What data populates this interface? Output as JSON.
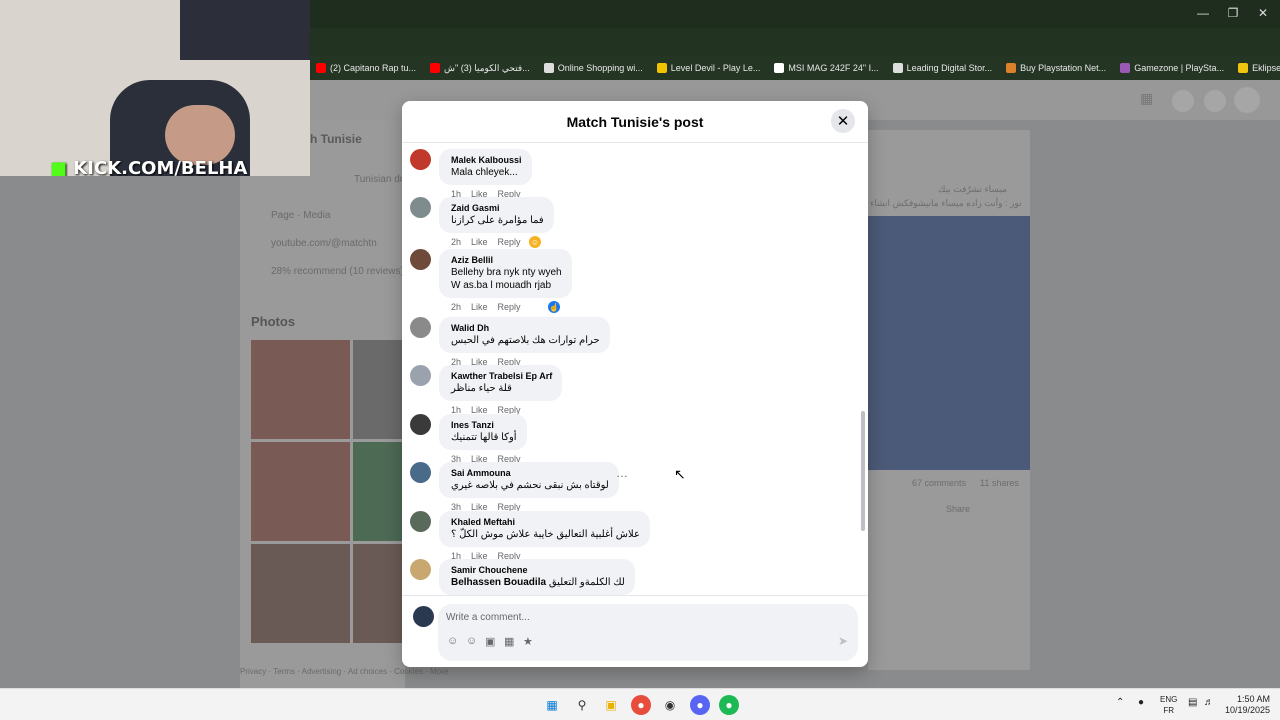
{
  "browser": {
    "bookmarks": [
      {
        "label": "(2) Capitano Rap tu...",
        "icon": "youtube-icon",
        "color": "#ff0000"
      },
      {
        "label": "فتحي الكوميا (3) \"ش...",
        "icon": "youtube-icon",
        "color": "#ff0000"
      },
      {
        "label": "Online Shopping wi...",
        "icon": "shopping-icon",
        "color": "#dddddd"
      },
      {
        "label": "Level Devil - Play Le...",
        "icon": "game-icon",
        "color": "#f2c300"
      },
      {
        "label": "MSI MAG 242F 24\" I...",
        "icon": "msi-icon",
        "color": "#ffffff"
      },
      {
        "label": "Leading Digital Stor...",
        "icon": "store-icon",
        "color": "#dddddd"
      },
      {
        "label": "Buy Playstation Net...",
        "icon": "playstation-icon",
        "color": "#d9822b"
      },
      {
        "label": "Gamezone | PlaySta...",
        "icon": "gamezone-icon",
        "color": "#9b59b6"
      },
      {
        "label": "Eklipse - Convert Tw...",
        "icon": "eklipse-icon",
        "color": "#f1c40f"
      }
    ]
  },
  "stream_overlay": {
    "channel": "KICK.COM/BELHA"
  },
  "background_page": {
    "page_name": "h Tunisie",
    "subtitle": "Tunisian dr",
    "info": [
      "Page · Media",
      "youtube.com/@matchtn",
      "28% recommend (10 reviews)"
    ],
    "photos_title": "Photos",
    "stats": {
      "comments": "67 comments",
      "shares": "11 shares"
    },
    "share_label": "Share",
    "footer": "Privacy · Terms · Advertising · Ad choices · Cookies · More",
    "right_text_line1": "ميساء تشرّفت بيك",
    "right_text_line2": "نور : وأنت زاده ميساء مانيشوفكش انشاء"
  },
  "modal": {
    "title": "Match Tunisie's post",
    "like_label": "Like",
    "reply_label": "Reply",
    "comments": [
      {
        "author": "Malek Kalboussi",
        "lines": [
          "Mala chleyek..."
        ],
        "time": "1h",
        "avatar_color": "#c0392b"
      },
      {
        "author": "Zaid Gasmi",
        "lines": [
          "فما مؤامرة على كرازنا"
        ],
        "time": "2h",
        "avatar_color": "#7f8c8d",
        "reaction": "haha-icon"
      },
      {
        "author": "Aziz Bellil",
        "lines": [
          "Bellehy bra nyk nty wyeh",
          "W as.ba l mouadh rjab"
        ],
        "time": "2h",
        "avatar_color": "#6e4a3a",
        "reaction": "like-icon"
      },
      {
        "author": "Walid Dh",
        "lines": [
          "حرام توارات هك بلاصتهم في الحبس"
        ],
        "time": "2h",
        "avatar_color": "#8a8a8a"
      },
      {
        "author": "Kawther Trabelsi Ep Arf",
        "lines": [
          "قلة حياء مناظر"
        ],
        "time": "1h",
        "avatar_color": "#9aa3ad"
      },
      {
        "author": "Ines Tanzi",
        "lines": [
          "أوكا قالها تتمنيك"
        ],
        "time": "3h",
        "avatar_color": "#3a3a3a"
      },
      {
        "author": "Sai Ammouna",
        "lines": [
          "لوقتاه بش نبقى نحشم في بلاصه غيري"
        ],
        "time": "3h",
        "avatar_color": "#4a6a8a"
      },
      {
        "author": "Khaled Meftahi",
        "lines": [
          "علاش أغلبية التعاليق خايبة علاش موش الكلّ ؟"
        ],
        "time": "1h",
        "avatar_color": "#5a6a5a"
      },
      {
        "author": "Samir Chouchene",
        "tag": "Belhassen Bouadila",
        "lines": [
          "لك الكلمةو التعليق"
        ],
        "time": "",
        "avatar_color": "#c8a870"
      }
    ],
    "composer_placeholder": "Write a comment..."
  },
  "taskbar": {
    "language": [
      "ENG",
      "FR"
    ],
    "time": "1:50 AM",
    "date": "10/19/2025"
  }
}
